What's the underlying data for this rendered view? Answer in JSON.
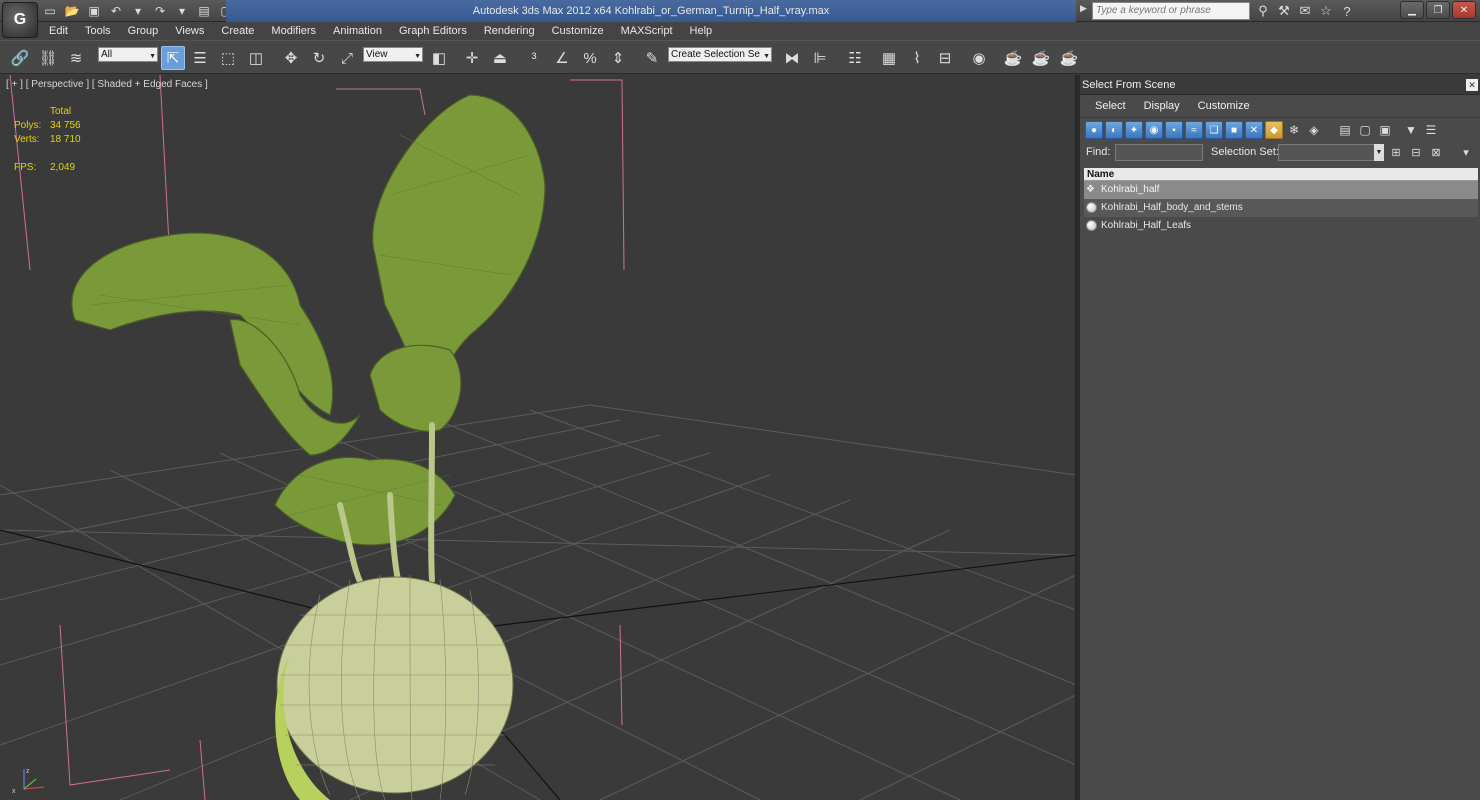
{
  "titlebar": {
    "app_logo": "G",
    "title": "Autodesk 3ds Max  2012 x64       Kohlrabi_or_German_Turnip_Half_vray.max",
    "search_placeholder": "Type a keyword or phrase"
  },
  "menu": [
    "Edit",
    "Tools",
    "Group",
    "Views",
    "Create",
    "Modifiers",
    "Animation",
    "Graph Editors",
    "Rendering",
    "Customize",
    "MAXScript",
    "Help"
  ],
  "toolbar": {
    "filter_value": "All",
    "coord_value": "View",
    "selection_set_value": "Create Selection Se"
  },
  "viewport": {
    "label": "[ + ] [ Perspective ] [ Shaded + Edged Faces ]",
    "stats": {
      "header": "Total",
      "polys_label": "Polys:",
      "polys_value": "34 756",
      "verts_label": "Verts:",
      "verts_value": "18 710",
      "fps_label": "FPS:",
      "fps_value": "2,049"
    },
    "colors": {
      "stats": "#e6d400",
      "leaf": "#7a9a3a",
      "bulb": "#c8cf9a",
      "grid": "#5a5a5a",
      "bbox": "#d0709a"
    }
  },
  "panel": {
    "title": "Select From Scene",
    "menu": [
      "Select",
      "Display",
      "Customize"
    ],
    "find_label": "Find:",
    "selection_set_label": "Selection Set:",
    "column_name": "Name",
    "items": [
      {
        "label": "Kohlrabi_half",
        "state": "selected",
        "icon": "group-icon"
      },
      {
        "label": "Kohlrabi_Half_body_and_stems",
        "state": "hover",
        "icon": "sphere-icon"
      },
      {
        "label": "Kohlrabi_Half_Leafs",
        "state": "normal",
        "icon": "sphere-icon"
      }
    ]
  }
}
